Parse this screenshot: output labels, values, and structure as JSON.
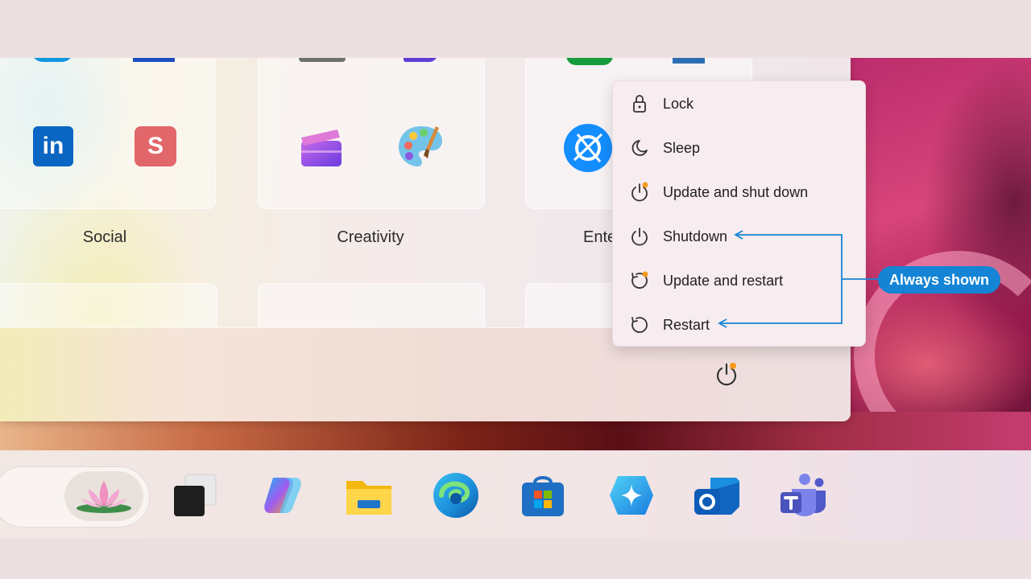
{
  "groups": [
    {
      "name": "Social"
    },
    {
      "name": "Creativity"
    },
    {
      "name": "Ente"
    }
  ],
  "apps": {
    "linkedin": {
      "text": "in",
      "color": "#0a66c2"
    },
    "swiftkey": {
      "text": "S",
      "color": "#e1676a"
    }
  },
  "power_menu": {
    "items": [
      {
        "label": "Lock",
        "icon": "lock-icon"
      },
      {
        "label": "Sleep",
        "icon": "moon-icon"
      },
      {
        "label": "Update and shut down",
        "icon": "update-power-icon"
      },
      {
        "label": "Shutdown",
        "icon": "power-icon"
      },
      {
        "label": "Update and restart",
        "icon": "update-restart-icon"
      },
      {
        "label": "Restart",
        "icon": "restart-icon"
      }
    ]
  },
  "annotation": {
    "callout": "Always shown",
    "color": "#1584d5"
  },
  "taskbar": {
    "icons": [
      "task-view-icon",
      "copilot-icon",
      "file-explorer-icon",
      "edge-icon",
      "store-icon",
      "copilot-plus-icon",
      "outlook-icon",
      "teams-icon"
    ]
  },
  "colors": {
    "badge": "#f59b1b",
    "accent": "#1584d5"
  }
}
